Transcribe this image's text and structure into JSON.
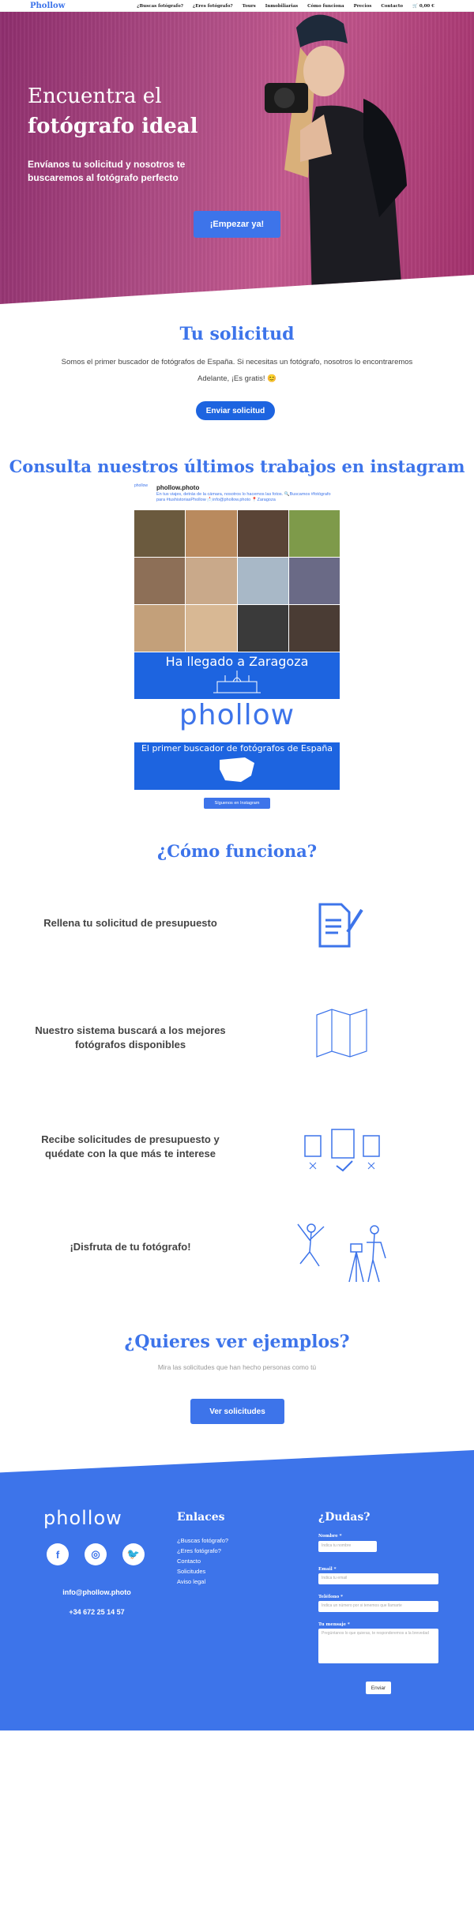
{
  "nav": {
    "logo": "Phollow",
    "items": [
      "¿Buscas fotógrafo?",
      "¿Eres fotógrafo?",
      "Tours",
      "Inmobiliarias",
      "Cómo funciona",
      "Precios",
      "Contacto",
      "🛒 0,00 €"
    ]
  },
  "hero": {
    "title_line1": "Encuentra el",
    "title_line2": "fotógrafo ideal",
    "subtitle": "Envíanos tu solicitud y nosotros te buscaremos al fotógrafo perfecto",
    "cta": "¡Empezar ya!"
  },
  "solicitud": {
    "title": "Tu solicitud",
    "text1": "Somos el primer buscador de fotógrafos de España. Si necesitas un fotógrafo, nosotros lo encontraremos",
    "text2": "Adelante, ¡Es gratis! 😊",
    "button": "Enviar solicitud"
  },
  "instagram": {
    "title": "Consulta nuestros últimos trabajos en instagram",
    "avatar": "phollow",
    "name": "phollow.photo",
    "bio": "En tus viajes, detrás de la cámara, nosotros lo hacemos las fotos. 🔍Buscamos #fotógrafo para #tushistoriasPhollow 📩info@phollow.photo 📍Zaragoza",
    "banner1": "Ha llegado a Zaragoza",
    "logo_text": "phollow",
    "banner2": "El primer buscador de fotógrafos de España",
    "follow": "Síguenos en Instagram",
    "tile_colors": [
      "#6b5a3e",
      "#b98a5e",
      "#5a4436",
      "#7e9a4a",
      "#8d6f57",
      "#c9a98a",
      "#a8b8c7",
      "#6a6a86",
      "#c3a07a",
      "#d8b894",
      "#3a3a3a",
      "#4a3c34"
    ]
  },
  "como": {
    "title": "¿Cómo funciona?",
    "steps": [
      "Rellena tu solicitud de presupuesto",
      "Nuestro sistema buscará a los mejores fotógrafos disponibles",
      "Recibe solicitudes de presupuesto y quédate con la que más te interese",
      "¡Disfruta de tu fotógrafo!"
    ]
  },
  "ejemplos": {
    "title": "¿Quieres ver ejemplos?",
    "text": "Mira las solicitudes que han hecho personas como tú",
    "button": "Ver solicitudes"
  },
  "footer": {
    "logo": "phollow",
    "email": "info@phollow.photo",
    "phone": "+34 672 25 14 57",
    "links_title": "Enlaces",
    "links": [
      "¿Buscas fotógrafo?",
      "¿Eres fotógrafo?",
      "Contacto",
      "Solicitudes",
      "Aviso legal"
    ],
    "dudas_title": "¿Dudas?",
    "form": {
      "name_label": "Nombre *",
      "name_ph": "Indica tu nombre",
      "email_label": "Email *",
      "email_ph": "Indica tu email",
      "phone_label": "Teléfono *",
      "phone_ph": "Indica un número por si tenemos que llamarte",
      "msg_label": "Tu mensaje *",
      "msg_ph": "Pregúntanos lo que quieras, te responderemos a la brevedad",
      "send": "Enviar"
    }
  },
  "colors": {
    "brand": "#3d74ea",
    "button": "#1d64e0"
  }
}
